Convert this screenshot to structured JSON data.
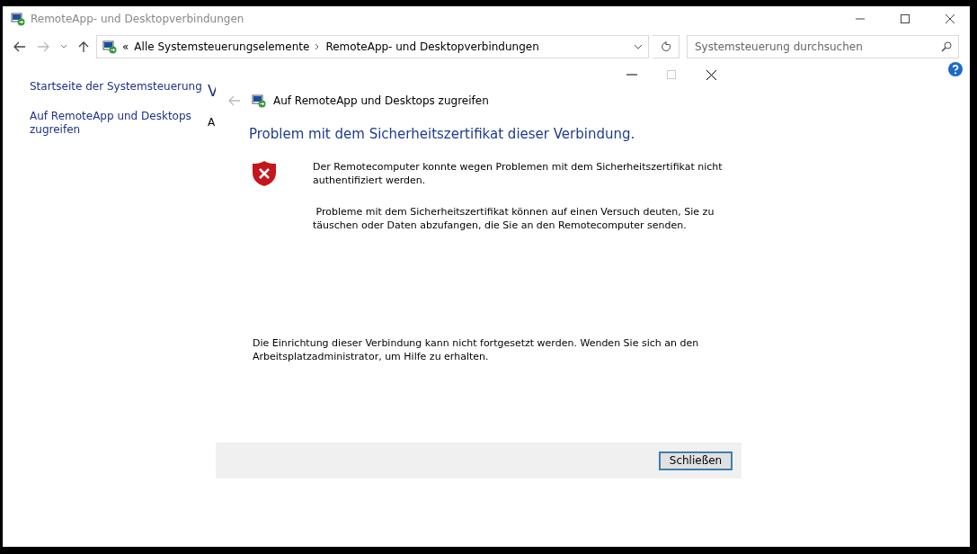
{
  "window": {
    "title": "RemoteApp- und Desktopverbindungen"
  },
  "address_bar": {
    "prefix": "«",
    "crumbs": [
      "Alle Systemsteuerungselemente",
      "RemoteApp- und Desktopverbindungen"
    ]
  },
  "search": {
    "placeholder": "Systemsteuerung durchsuchen"
  },
  "sidebar": {
    "items": [
      {
        "label": "Startseite der Systemsteuerung"
      },
      {
        "label": "Auf RemoteApp und Desktops zugreifen"
      }
    ]
  },
  "main": {
    "heading_fragment": "V",
    "text_fragment": "A"
  },
  "dialog": {
    "header": "Auf RemoteApp und Desktops zugreifen",
    "title": "Problem mit dem Sicherheitszertifikat dieser Verbindung.",
    "messages": [
      "Der Remotecomputer konnte wegen Problemen mit dem Sicherheitszertifikat nicht authentifiziert werden.",
      " Probleme mit dem Sicherheitszertifikat können auf einen Versuch deuten, Sie zu täuschen oder Daten abzufangen, die Sie an den Remotecomputer senden."
    ],
    "note": "Die Einrichtung dieser Verbindung kann nicht fortgesetzt werden. Wenden Sie sich an den Arbeitsplatzadministrator, um Hilfe zu erhalten.",
    "buttons": [
      "Schließen"
    ]
  }
}
